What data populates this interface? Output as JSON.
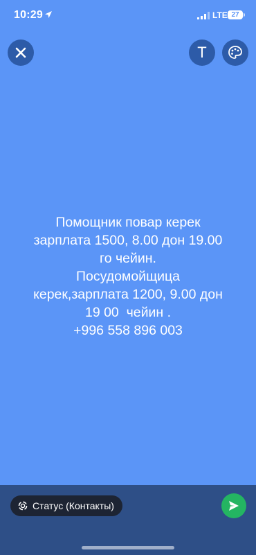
{
  "status_bar": {
    "time": "10:29",
    "network": "LTE",
    "battery_level": "27",
    "icons": [
      "location-arrow-icon",
      "signal-icon",
      "battery-icon"
    ]
  },
  "toolbar": {
    "close_icon": "close-icon",
    "text_button_label": "T",
    "palette_icon": "palette-icon"
  },
  "message": {
    "lines": [
      "Помощник повар керек",
      "зарплата 1500, 8.00 дон 19.00",
      "го чейин.",
      "Посудомойщица",
      "керек,зарплата 1200, 9.00 дон",
      "19 00  чейин .",
      "+996 558 896 003"
    ]
  },
  "bottom_bar": {
    "audience_label": "Статус (Контакты)",
    "send_icon": "send-icon"
  },
  "colors": {
    "background": "#5b95f7",
    "button_bg": "#2d5ba8",
    "bottom_bar": "#2e4f87",
    "pill": "#1d2433",
    "send": "#24b562"
  }
}
